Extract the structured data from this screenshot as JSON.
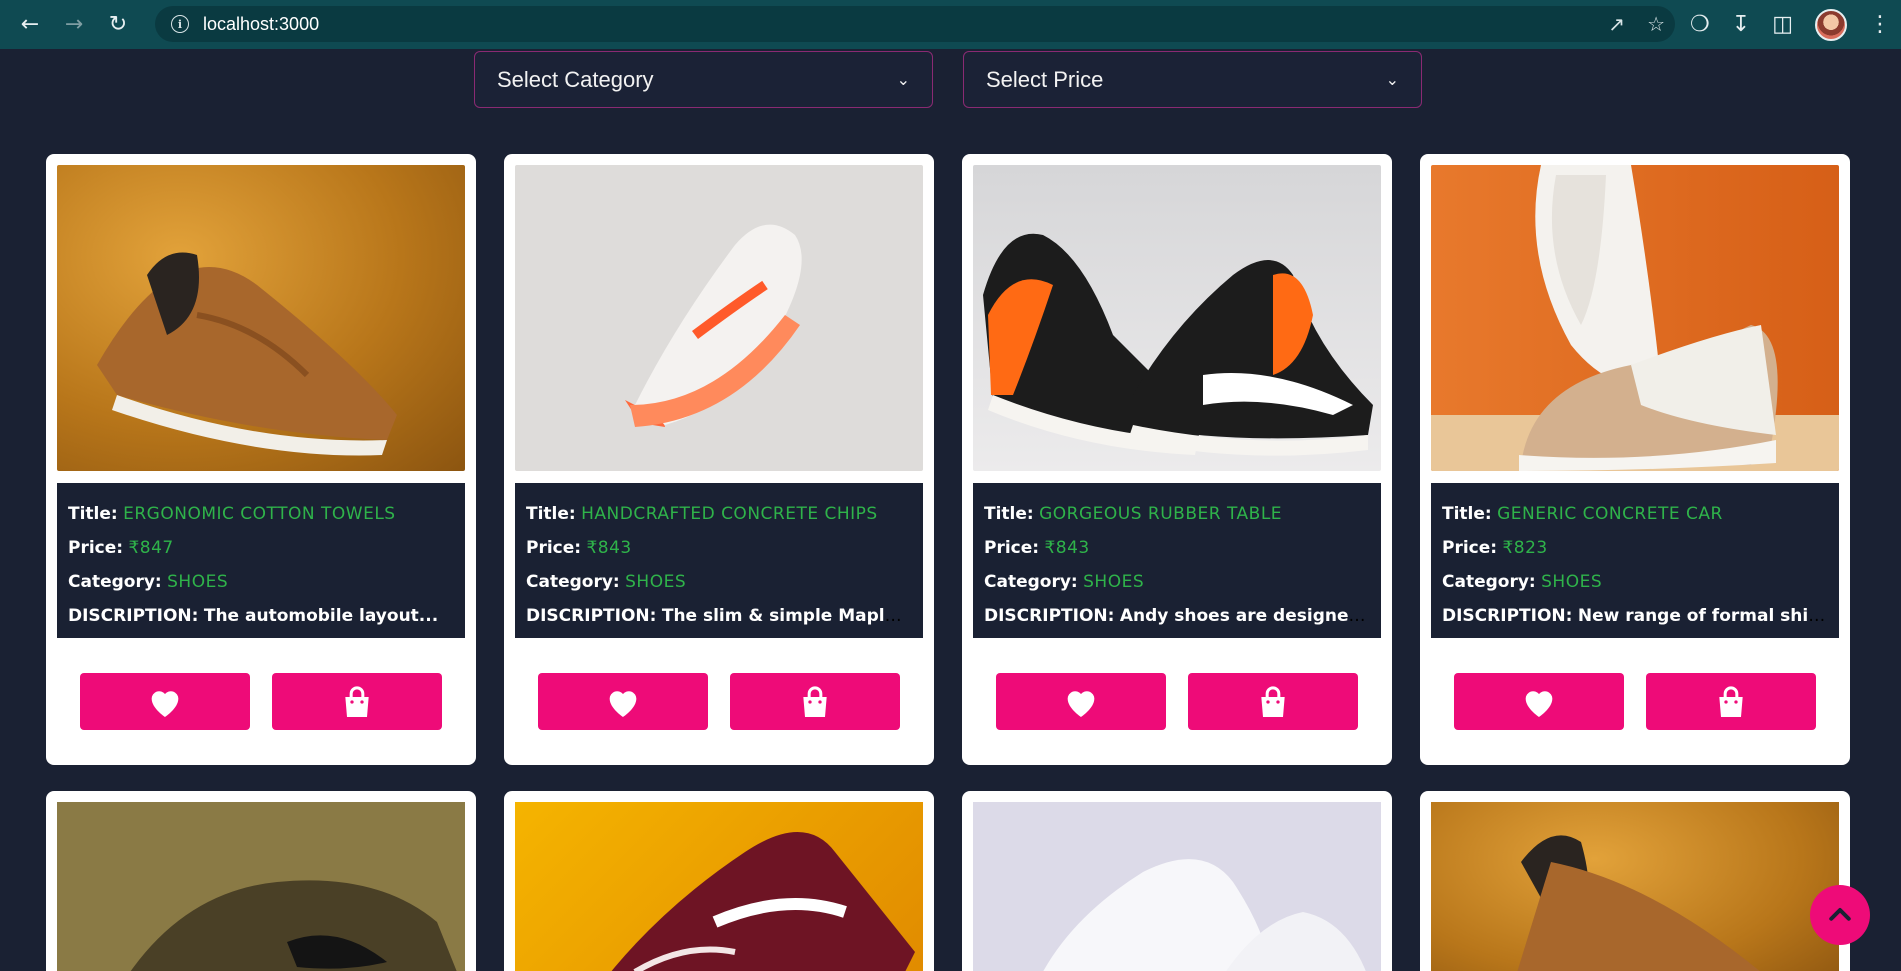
{
  "browser": {
    "url": "localhost:3000"
  },
  "filters": {
    "category_label": "Select Category",
    "price_label": "Select Price"
  },
  "labels": {
    "title": "Title:",
    "price": "Price:",
    "category": "Category:",
    "description": "DISCRIPTION:"
  },
  "products": [
    {
      "title": "ERGONOMIC COTTON TOWELS",
      "price": "₹847",
      "category": "SHOES",
      "description": "The automobile layout..."
    },
    {
      "title": "HANDCRAFTED CONCRETE CHIPS",
      "price": "₹843",
      "category": "SHOES",
      "description": "The slim & simple Maple..."
    },
    {
      "title": "GORGEOUS RUBBER TABLE",
      "price": "₹843",
      "category": "SHOES",
      "description": "Andy shoes are designed to..."
    },
    {
      "title": "GENERIC CONCRETE CAR",
      "price": "₹823",
      "category": "SHOES",
      "description": "New range of formal shirts..."
    }
  ],
  "colors": {
    "accent": "#ee0b78",
    "value_green": "#2fb34a",
    "background": "#1a2133"
  }
}
